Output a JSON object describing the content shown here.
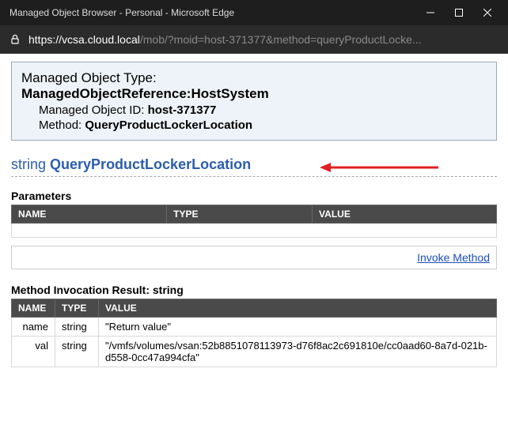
{
  "window": {
    "title": "Managed Object Browser - Personal - Microsoft Edge"
  },
  "address": {
    "host": "https://vcsa.cloud.local",
    "path": "/mob/?moid=host-371377&method=queryProductLocke..."
  },
  "info": {
    "type_label": "Managed Object Type:",
    "type_value": "ManagedObjectReference:HostSystem",
    "id_label": "Managed Object ID:",
    "id_value": "host-371377",
    "method_label": "Method:",
    "method_value": "QueryProductLockerLocation"
  },
  "method_heading": {
    "return_type": "string",
    "name": "QueryProductLockerLocation"
  },
  "parameters": {
    "title": "Parameters",
    "headers": {
      "name": "NAME",
      "type": "TYPE",
      "value": "VALUE"
    }
  },
  "invoke": {
    "label": "Invoke Method"
  },
  "result": {
    "title": "Method Invocation Result: string",
    "headers": {
      "name": "NAME",
      "type": "TYPE",
      "value": "VALUE"
    },
    "rows": [
      {
        "name": "name",
        "type": "string",
        "value": "\"Return value\""
      },
      {
        "name": "val",
        "type": "string",
        "value": "\"/vmfs/volumes/vsan:52b8851078113973-d76f8ac2c691810e/cc0aad60-8a7d-021b-d558-0cc47a994cfa\""
      }
    ]
  }
}
